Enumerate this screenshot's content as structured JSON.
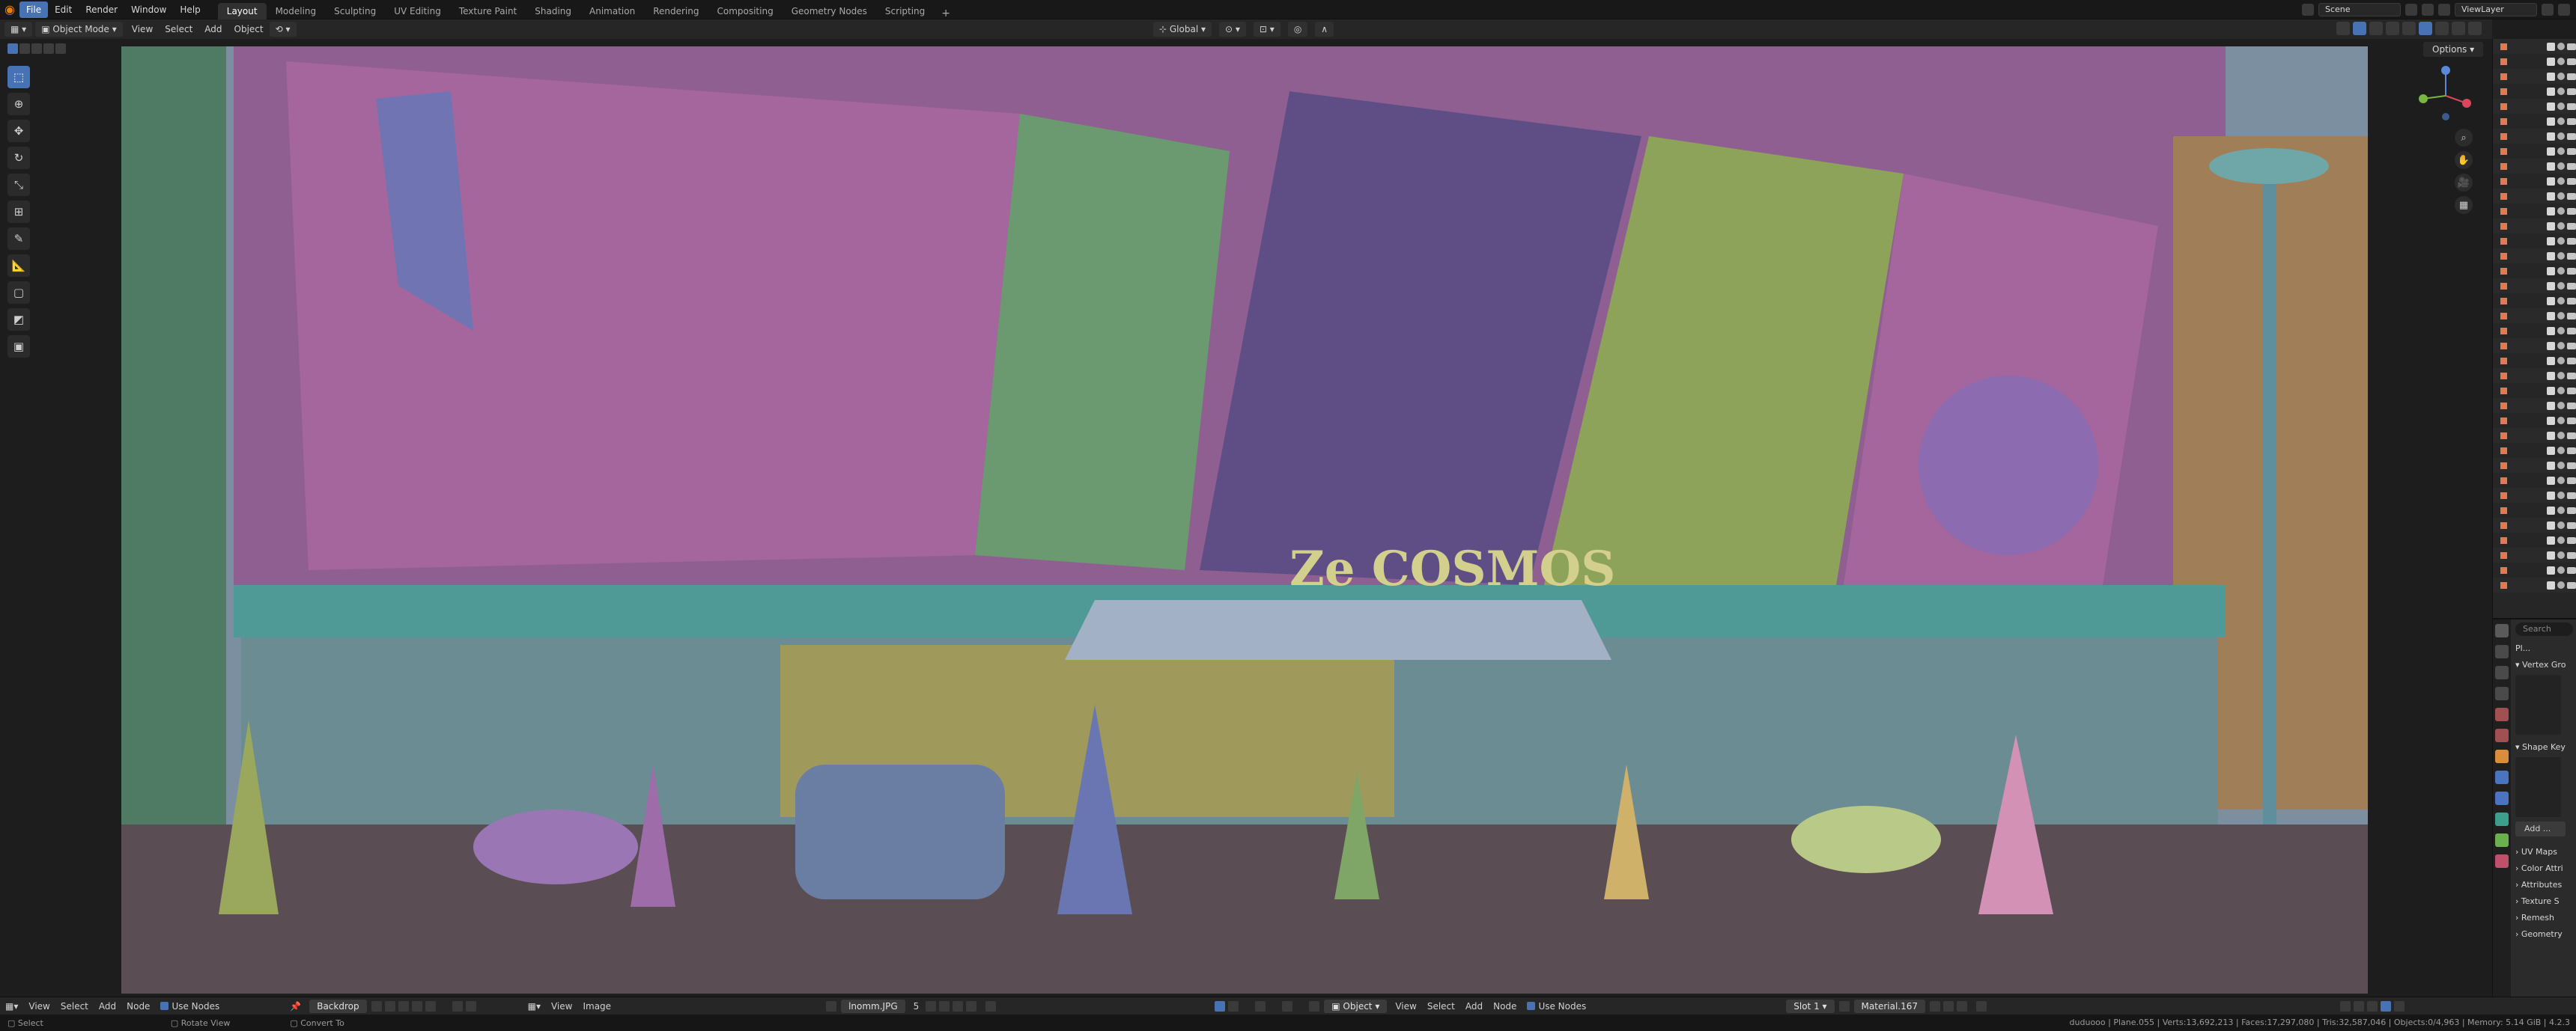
{
  "topbar": {
    "menus": [
      "File",
      "Edit",
      "Render",
      "Window",
      "Help"
    ],
    "workspaces": [
      "Layout",
      "Modeling",
      "Sculpting",
      "UV Editing",
      "Texture Paint",
      "Shading",
      "Animation",
      "Rendering",
      "Compositing",
      "Geometry Nodes",
      "Scripting"
    ],
    "active_workspace": "Layout",
    "scene": "Scene",
    "view_layer": "ViewLayer",
    "add_tab": "+"
  },
  "viewport_header": {
    "mode": "Object Mode",
    "menus": [
      "View",
      "Select",
      "Add",
      "Object"
    ],
    "orientation": "Global"
  },
  "toolbar": {
    "tools": [
      "select-box",
      "cursor",
      "move",
      "rotate",
      "scale",
      "transform",
      "annotate",
      "measure",
      "add-cube",
      "extrude",
      "shrink"
    ]
  },
  "viewport": {
    "options_label": "Options",
    "sign_text": "Ze COSMOS",
    "gizmo_axes": [
      "X",
      "Y",
      "Z"
    ]
  },
  "outliner": {
    "row_count": 37
  },
  "properties": {
    "object_name": "Pl...",
    "search_placeholder": "Search",
    "sections": [
      "Vertex Gro",
      "Shape Key",
      "UV Maps",
      "Color Attri",
      "Attributes",
      "Texture S",
      "Remesh",
      "Geometry"
    ],
    "add_label": "Add ..."
  },
  "node_editor_left": {
    "menus": [
      "View",
      "Select",
      "Add",
      "Node"
    ],
    "use_nodes_label": "Use Nodes",
    "backdrop_label": "Backdrop"
  },
  "image_editor": {
    "menus": [
      "View",
      "Image"
    ],
    "image_name": "lnomm.JPG",
    "users": "5"
  },
  "node_editor_right": {
    "type": "Object",
    "menus": [
      "View",
      "Select",
      "Add",
      "Node"
    ],
    "use_nodes_label": "Use Nodes",
    "slot": "Slot 1",
    "material": "Material.167"
  },
  "statusbar": {
    "left": [
      "Select",
      "Rotate View",
      "Convert To"
    ],
    "stats": "duduooo | Plane.055 | Verts:13,692,213 | Faces:17,297,080 | Tris:32,587,046 | Objects:0/4,963 | Memory: 5.14 GiB | 4.2.3"
  },
  "colors": {
    "accent": "#4772b3",
    "logo": "#e87d0d",
    "ui_bg": "#1d1d1d"
  }
}
